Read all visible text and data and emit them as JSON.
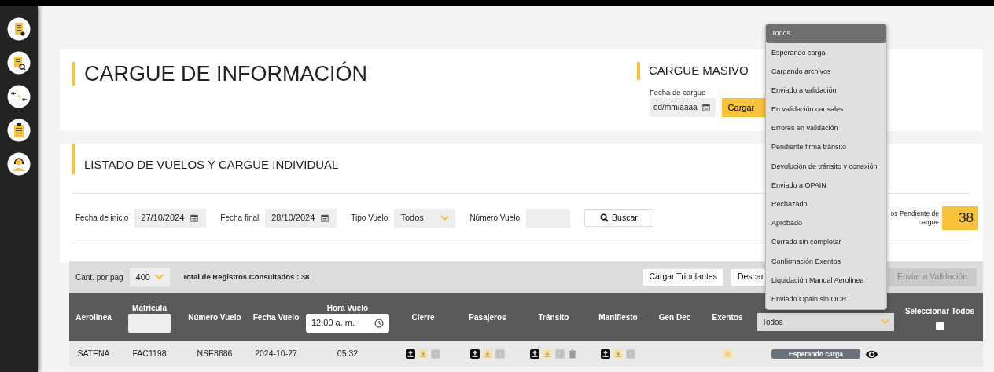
{
  "header": {
    "title": "CARGUE DE INFORMACIÓN"
  },
  "bulk_upload": {
    "title": "CARGUE MASIVO",
    "date_label": "Fecha de cargue",
    "date_placeholder": "dd/mm/aaaa",
    "button": "Cargar"
  },
  "flights": {
    "title": "LISTADO DE VUELOS Y CARGUE INDIVIDUAL",
    "filters": [
      {
        "kind": "date",
        "label": "Fecha de inicio",
        "value": "27/10/2024"
      },
      {
        "kind": "date",
        "label": "Fecha final",
        "value": "28/10/2024"
      },
      {
        "kind": "select",
        "label": "Tipo Vuelo",
        "value": "Todos"
      },
      {
        "kind": "text",
        "label": "Número Vuelo"
      }
    ],
    "search_button": "Buscar",
    "pending": {
      "label": "os Pendiente de cargue",
      "count": "38"
    }
  },
  "toolbar": {
    "page_size_label": "Cant. por pag",
    "page_size": "400",
    "total": "Total de Registros Consultados : 38",
    "buttons": [
      {
        "label": "Cargar Tripulantes",
        "disabled": false
      },
      {
        "label": "Descar",
        "disabled": false
      },
      {
        "label": "Enviar a Validación",
        "disabled": true
      }
    ]
  },
  "table": {
    "columns": [
      {
        "label": "Aerolinea"
      },
      {
        "label": "Matrícula",
        "filter": {
          "kind": "text"
        }
      },
      {
        "label": "Número Vuelo"
      },
      {
        "label": "Fecha Vuelo"
      },
      {
        "label": "Hora Vuelo",
        "filter": {
          "kind": "time",
          "value": "12:00 a. m."
        }
      },
      {
        "label": "Cierre"
      },
      {
        "label": "Pasajeros"
      },
      {
        "label": "Tránsito"
      },
      {
        "label": "Manifiesto"
      },
      {
        "label": "Gen Dec"
      },
      {
        "label": "Exentos"
      },
      {
        "filter": {
          "kind": "select",
          "value": "Todos"
        }
      },
      {
        "label": "Seleccionar Todos",
        "filter": {
          "kind": "checkbox",
          "checked": false
        }
      }
    ],
    "rows": [
      {
        "cells": [
          {
            "kind": "text",
            "text": "SATENA"
          },
          {
            "kind": "text",
            "text": "FAC1198"
          },
          {
            "kind": "text",
            "text": "NSE8686"
          },
          {
            "kind": "text",
            "text": "2024-10-27"
          },
          {
            "kind": "text",
            "text": "05:32"
          },
          {
            "kind": "actions",
            "actions": [
              {
                "kind": "upload"
              },
              {
                "kind": "download"
              },
              {
                "kind": "document"
              }
            ]
          },
          {
            "kind": "actions",
            "actions": [
              {
                "kind": "upload"
              },
              {
                "kind": "download"
              },
              {
                "kind": "document"
              }
            ]
          },
          {
            "kind": "actions",
            "actions": [
              {
                "kind": "upload"
              },
              {
                "kind": "download"
              },
              {
                "kind": "document"
              },
              {
                "kind": "delete"
              }
            ]
          },
          {
            "kind": "actions",
            "actions": [
              {
                "kind": "upload"
              },
              {
                "kind": "download"
              },
              {
                "kind": "document"
              }
            ]
          },
          {
            "kind": "empty"
          },
          {
            "kind": "actions",
            "actions": [
              {
                "kind": "list"
              }
            ]
          },
          {
            "kind": "status",
            "text": "Esperando carga",
            "actions": [
              {
                "kind": "view"
              }
            ]
          },
          {
            "kind": "empty"
          }
        ]
      }
    ]
  },
  "status_dropdown": {
    "options": [
      {
        "label": "Todos",
        "selected": true
      },
      {
        "label": "Esperando carga",
        "selected": false
      },
      {
        "label": "Cargando archivos",
        "selected": false
      },
      {
        "label": "Enviado a validación",
        "selected": false
      },
      {
        "label": "En validación causales",
        "selected": false
      },
      {
        "label": "Errores en validación",
        "selected": false
      },
      {
        "label": "Pendiente firma tránsito",
        "selected": false
      },
      {
        "label": "Devolución de tránsito y conexión",
        "selected": false
      },
      {
        "label": "Enviado a OPAIN",
        "selected": false
      },
      {
        "label": "Rechazado",
        "selected": false
      },
      {
        "label": "Aprobado",
        "selected": false
      },
      {
        "label": "Cerrado sin completar",
        "selected": false
      },
      {
        "label": "Confirmación Exentos",
        "selected": false
      },
      {
        "label": "Liquidación Manual Aerolinea",
        "selected": false
      },
      {
        "label": "Enviado Opain sin OCR",
        "selected": false
      }
    ]
  }
}
